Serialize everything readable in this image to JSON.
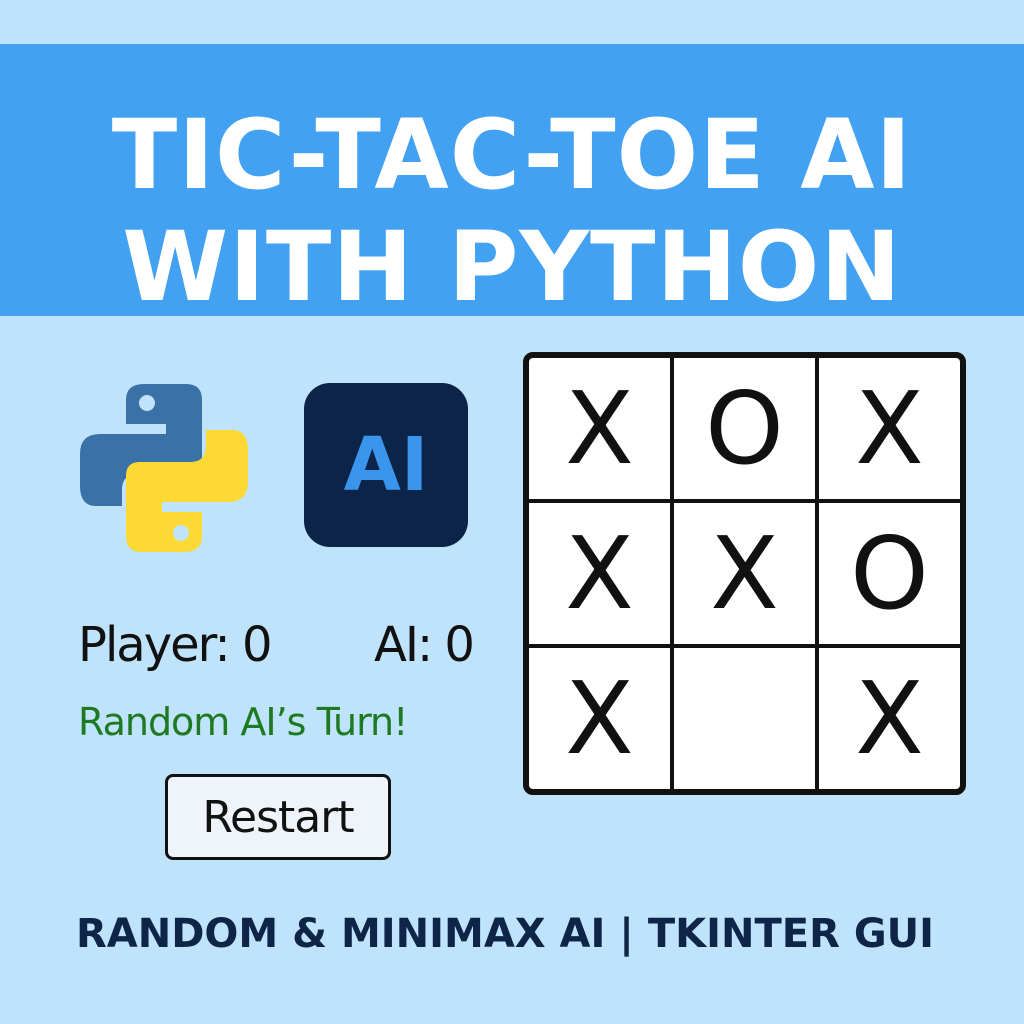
{
  "header": {
    "title_line1": "TIC-TAC-TOE AI",
    "title_line2": "WITH PYTHON"
  },
  "logos": {
    "python_icon": "python-logo-icon",
    "ai_badge_label": "AI",
    "colors": {
      "python_blue": "#3a72a8",
      "python_yellow": "#fcd935",
      "ai_badge_bg": "#0b2447",
      "ai_badge_text": "#3a95ec"
    }
  },
  "scoreboard": {
    "player_label": "Player: 0",
    "ai_label": "AI: 0"
  },
  "status": {
    "message": "Random AI’s Turn!",
    "color": "#1e7a22"
  },
  "controls": {
    "restart_label": "Restart"
  },
  "board": {
    "cells": [
      "X",
      "O",
      "X",
      "X",
      "X",
      "O",
      "X",
      "",
      "X"
    ]
  },
  "footer": {
    "text": "RANDOM & MINIMAX AI | TKINTER GUI"
  },
  "colors": {
    "background": "#bfe3fb",
    "banner": "#42a1f1",
    "footer_text": "#0f2547"
  }
}
